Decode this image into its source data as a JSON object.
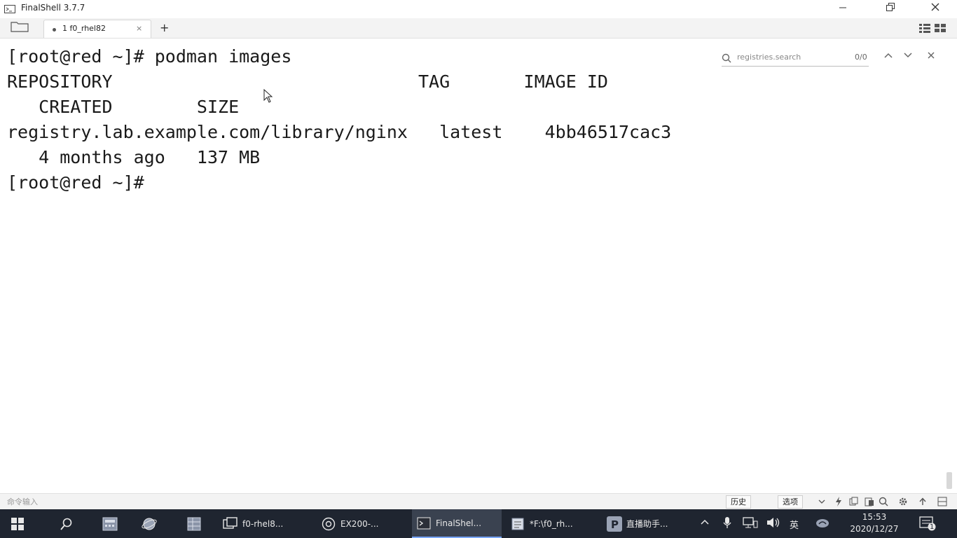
{
  "window": {
    "title": "FinalShell 3.7.7",
    "minimize_icon": "minimize-icon",
    "maximize_icon": "restore-icon",
    "close_icon": "close-icon"
  },
  "tabs": {
    "items": [
      {
        "label": "1  f0_rhel82",
        "active": true
      }
    ],
    "close_glyph": "×",
    "add_glyph": "+"
  },
  "terminal": {
    "lines": [
      "[root@red ~]# podman images",
      "REPOSITORY                             TAG       IMAGE ID",
      "   CREATED        SIZE",
      "registry.lab.example.com/library/nginx   latest    4bb46517cac3",
      "   4 months ago   137 MB",
      "[root@red ~]#"
    ],
    "search": {
      "placeholder": "registries.search",
      "count": "0/0"
    }
  },
  "command_bar": {
    "placeholder": "命令输入",
    "history_label": "历史",
    "options_label": "选项"
  },
  "taskbar": {
    "items": [
      {
        "label": "f0-rhel8..."
      },
      {
        "label": "EX200-..."
      },
      {
        "label": "FinalShel..."
      },
      {
        "label": "*F:\\f0_rh..."
      },
      {
        "label": "直播助手..."
      }
    ],
    "ime_label": "英",
    "notification_count": "1",
    "time": "15:53",
    "date": "2020/12/27"
  },
  "colors": {
    "terminal_bg": "#ffffff",
    "terminal_fg": "#1a1a1a",
    "taskbar_bg": "#1f2530",
    "accent": "#7aa7ff"
  }
}
